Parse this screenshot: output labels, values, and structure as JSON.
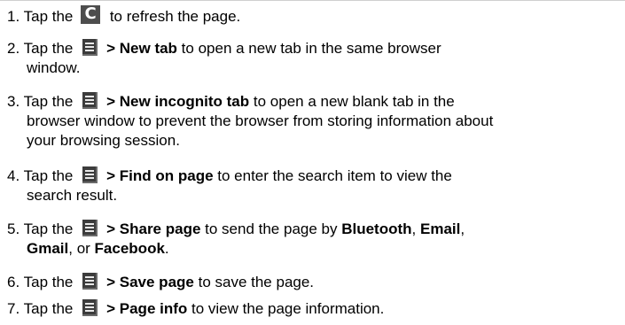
{
  "steps": [
    {
      "number": "1.",
      "tap": "Tap  the",
      "icon": "refresh-icon",
      "action": "",
      "desc": " to refresh the page."
    },
    {
      "number": "2.",
      "tap": "Tap  the",
      "icon": "menu-icon",
      "action": "> New tab",
      "desc": " to open a new tab in the same browser",
      "desc2": "window."
    },
    {
      "number": "3.",
      "tap": "Tap  the",
      "icon": "menu-icon",
      "action": "> New incognito tab",
      "desc": " to open a new blank tab in the",
      "desc2": "browser window to prevent the browser from storing information about",
      "desc3": "your browsing session."
    },
    {
      "number": "4.",
      "tap": "Tap  the",
      "icon": "menu-icon",
      "action": "> Find on page",
      "desc": " to enter the search item to view the",
      "desc2": "search result."
    },
    {
      "number": "5.",
      "tap": "Tap  the",
      "icon": "menu-icon",
      "action": "> Share page",
      "desc": " to send the page by ",
      "opt1": "Bluetooth",
      "sep1": ", ",
      "opt2": "Email",
      "sep2": ",",
      "opt3": "Gmail",
      "sep3": ", or ",
      "opt4": "Facebook",
      "end": "."
    },
    {
      "number": "6.",
      "tap": "Tap  the",
      "icon": "menu-icon",
      "action": "> Save page",
      "desc": " to save the page."
    },
    {
      "number": "7.",
      "tap": "Tap  the",
      "icon": "menu-icon",
      "action": "> Page info",
      "desc": " to view the page information."
    }
  ]
}
